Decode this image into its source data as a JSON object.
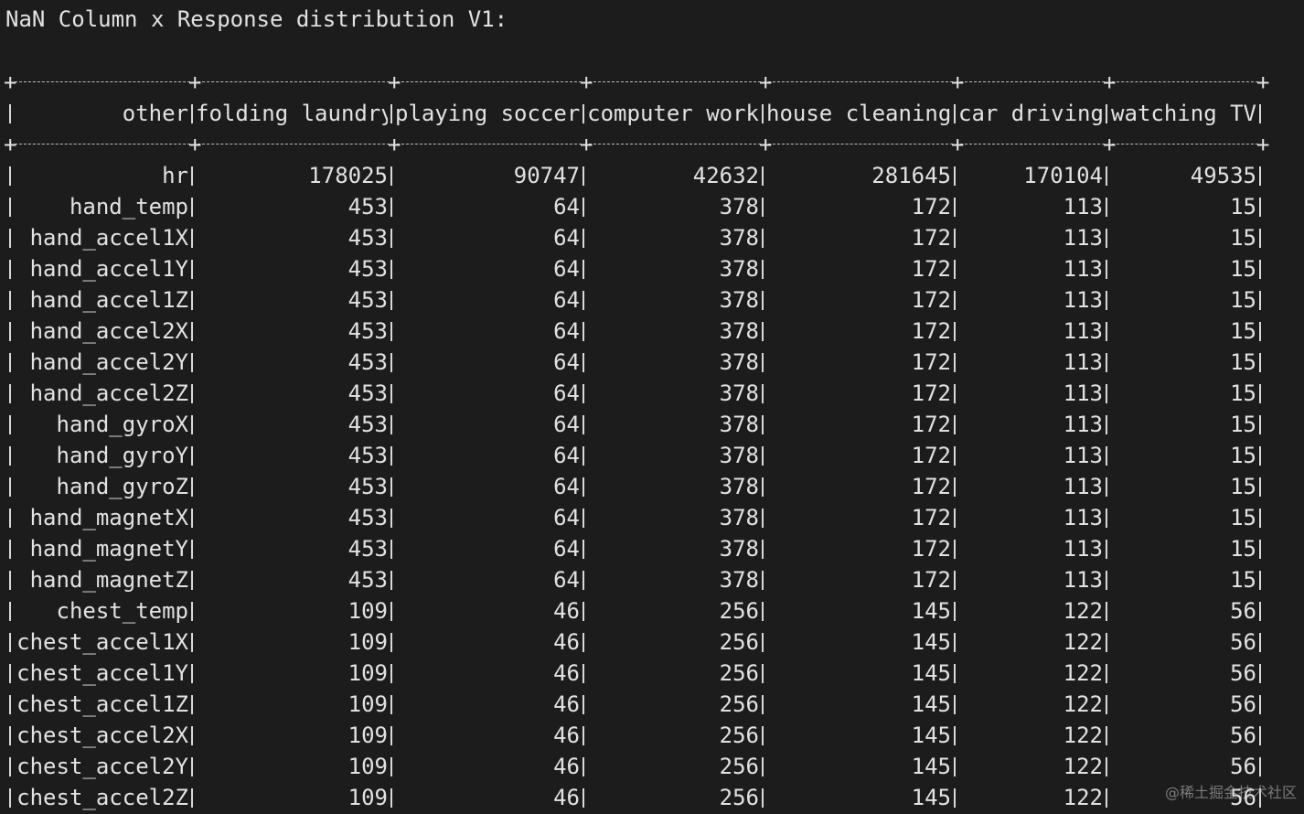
{
  "title": "NaN Column x Response distribution V1:",
  "table": {
    "header_corner": "other",
    "columns": [
      "folding laundry",
      "playing soccer",
      "computer work",
      "house cleaning",
      "car driving",
      "watching TV"
    ],
    "rows": [
      {
        "name": "hr",
        "values": [
          "178025",
          "90747",
          "42632",
          "281645",
          "170104",
          "49535"
        ]
      },
      {
        "name": "hand_temp",
        "values": [
          "453",
          "64",
          "378",
          "172",
          "113",
          "15"
        ]
      },
      {
        "name": "hand_accel1X",
        "values": [
          "453",
          "64",
          "378",
          "172",
          "113",
          "15"
        ]
      },
      {
        "name": "hand_accel1Y",
        "values": [
          "453",
          "64",
          "378",
          "172",
          "113",
          "15"
        ]
      },
      {
        "name": "hand_accel1Z",
        "values": [
          "453",
          "64",
          "378",
          "172",
          "113",
          "15"
        ]
      },
      {
        "name": "hand_accel2X",
        "values": [
          "453",
          "64",
          "378",
          "172",
          "113",
          "15"
        ]
      },
      {
        "name": "hand_accel2Y",
        "values": [
          "453",
          "64",
          "378",
          "172",
          "113",
          "15"
        ]
      },
      {
        "name": "hand_accel2Z",
        "values": [
          "453",
          "64",
          "378",
          "172",
          "113",
          "15"
        ]
      },
      {
        "name": "hand_gyroX",
        "values": [
          "453",
          "64",
          "378",
          "172",
          "113",
          "15"
        ]
      },
      {
        "name": "hand_gyroY",
        "values": [
          "453",
          "64",
          "378",
          "172",
          "113",
          "15"
        ]
      },
      {
        "name": "hand_gyroZ",
        "values": [
          "453",
          "64",
          "378",
          "172",
          "113",
          "15"
        ]
      },
      {
        "name": "hand_magnetX",
        "values": [
          "453",
          "64",
          "378",
          "172",
          "113",
          "15"
        ]
      },
      {
        "name": "hand_magnetY",
        "values": [
          "453",
          "64",
          "378",
          "172",
          "113",
          "15"
        ]
      },
      {
        "name": "hand_magnetZ",
        "values": [
          "453",
          "64",
          "378",
          "172",
          "113",
          "15"
        ]
      },
      {
        "name": "chest_temp",
        "values": [
          "109",
          "46",
          "256",
          "145",
          "122",
          "56"
        ]
      },
      {
        "name": "chest_accel1X",
        "values": [
          "109",
          "46",
          "256",
          "145",
          "122",
          "56"
        ]
      },
      {
        "name": "chest_accel1Y",
        "values": [
          "109",
          "46",
          "256",
          "145",
          "122",
          "56"
        ]
      },
      {
        "name": "chest_accel1Z",
        "values": [
          "109",
          "46",
          "256",
          "145",
          "122",
          "56"
        ]
      },
      {
        "name": "chest_accel2X",
        "values": [
          "109",
          "46",
          "256",
          "145",
          "122",
          "56"
        ]
      },
      {
        "name": "chest_accel2Y",
        "values": [
          "109",
          "46",
          "256",
          "145",
          "122",
          "56"
        ]
      },
      {
        "name": "chest_accel2Z",
        "values": [
          "109",
          "46",
          "256",
          "145",
          "122",
          "56"
        ]
      }
    ]
  },
  "watermark": "@稀土掘金技术社区"
}
